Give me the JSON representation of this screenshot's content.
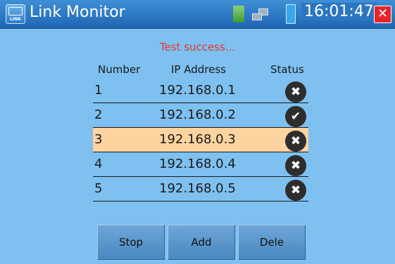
{
  "window": {
    "title": "Link Monitor",
    "app_icon_label": "LINK",
    "clock": "16:01:47",
    "close_label": "✕"
  },
  "status_message": "Test success...",
  "table": {
    "headers": {
      "number": "Number",
      "ip": "IP Address",
      "status": "Status"
    },
    "rows": [
      {
        "number": "1",
        "ip": "192.168.0.1",
        "status": "fail",
        "glyph": "✖"
      },
      {
        "number": "2",
        "ip": "192.168.0.2",
        "status": "success",
        "glyph": "✔"
      },
      {
        "number": "3",
        "ip": "192.168.0.3",
        "status": "fail",
        "glyph": "✖",
        "selected": true
      },
      {
        "number": "4",
        "ip": "192.168.0.4",
        "status": "fail",
        "glyph": "✖"
      },
      {
        "number": "5",
        "ip": "192.168.0.5",
        "status": "fail",
        "glyph": "✖"
      }
    ]
  },
  "buttons": {
    "stop": "Stop",
    "add": "Add",
    "dele": "Dele"
  },
  "colors": {
    "background": "#7ec0f0",
    "titlebar": "#2c76c0",
    "status_text": "#e8362e",
    "selected_row": "#fdd4a0",
    "close_button": "#e8242a"
  }
}
